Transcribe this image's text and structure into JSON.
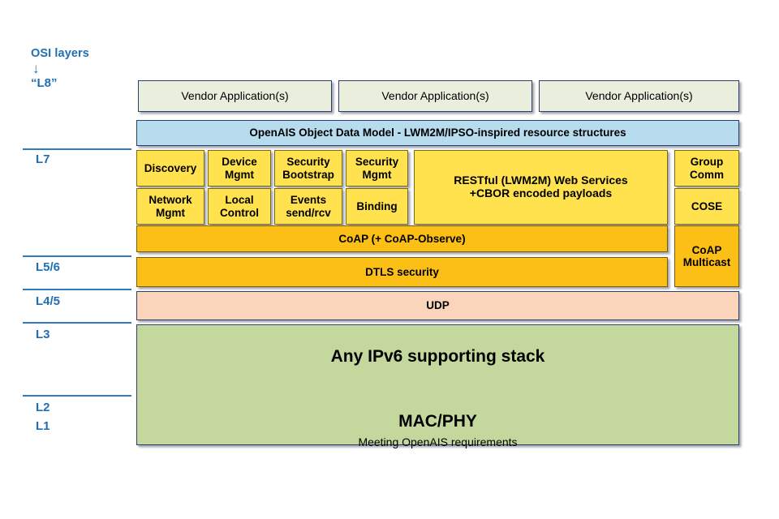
{
  "legend": {
    "title": "OSI layers",
    "arrow": "↓",
    "l8": "“L8”",
    "layers": [
      {
        "label": "L7"
      },
      {
        "label": "L5/6"
      },
      {
        "label": "L4/5"
      },
      {
        "label": "L3"
      },
      {
        "label": "L2"
      },
      {
        "label": "L1"
      }
    ]
  },
  "stack": {
    "vendor_apps": [
      {
        "label": "Vendor Application(s)"
      },
      {
        "label": "Vendor Application(s)"
      },
      {
        "label": "Vendor Application(s)"
      }
    ],
    "object_data_model": {
      "label": "OpenAIS Object Data Model - LWM2M/IPSO-inspired resource structures"
    },
    "l7_services_row1": [
      {
        "line1": "Discovery",
        "line2": ""
      },
      {
        "line1": "Device",
        "line2": "Mgmt"
      },
      {
        "line1": "Security",
        "line2": "Bootstrap"
      },
      {
        "line1": "Security",
        "line2": "Mgmt"
      }
    ],
    "l7_services_row2": [
      {
        "line1": "Network",
        "line2": "Mgmt"
      },
      {
        "line1": "Local",
        "line2": "Control"
      },
      {
        "line1": "Events",
        "line2": "send/rcv"
      },
      {
        "line1": "Binding",
        "line2": ""
      }
    ],
    "rest_services": {
      "line1": "RESTful (LWM2M) Web Services",
      "line2": "+CBOR encoded payloads"
    },
    "group_comm": {
      "line1": "Group",
      "line2": "Comm"
    },
    "cose": {
      "line1": "COSE",
      "line2": ""
    },
    "coap": {
      "label": "CoAP (+ CoAP-Observe)"
    },
    "dtls": {
      "label": "DTLS security"
    },
    "coap_multicast": {
      "line1": "CoAP",
      "line2": "Multicast"
    },
    "udp": {
      "label": "UDP"
    },
    "physical": {
      "ipv6": "Any IPv6 supporting stack",
      "macphy": "MAC/PHY",
      "meeting": "Meeting OpenAIS requirements"
    }
  },
  "colors": {
    "accent_blue": "#1f6fb4",
    "separator_blue": "#2e7cbe",
    "vendor_cream": "#eaeedc",
    "object_model_blue": "#b7dcee",
    "service_yellow": "#ffe24d",
    "transport_orange": "#fcbf16",
    "udp_peach": "#fbd5bb",
    "physical_green": "#c4d79d",
    "box_border": "#2c3e6b"
  }
}
